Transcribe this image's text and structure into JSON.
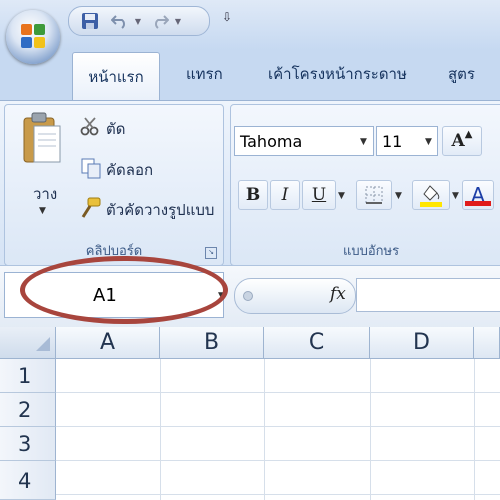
{
  "quick_access": {
    "icons": [
      "save-icon",
      "undo-icon",
      "redo-icon",
      "customize-icon"
    ]
  },
  "tabs": [
    "หน้าแรก",
    "แทรก",
    "เค้าโครงหน้ากระดาษ",
    "สูตร"
  ],
  "clipboard": {
    "paste_label": "วาง",
    "cut_label": "ตัด",
    "copy_label": "คัดลอก",
    "format_painter_label": "ตัวคัดวางรูปแบบ",
    "group_label": "คลิปบอร์ด"
  },
  "font": {
    "font_name": "Tahoma",
    "font_size": "11",
    "bold": "B",
    "italic": "I",
    "underline": "U",
    "grow_font": "A",
    "font_color_label": "A",
    "group_label": "แบบอักษร"
  },
  "formula_bar": {
    "name_box": "A1",
    "fx": "fx",
    "formula": ""
  },
  "grid": {
    "columns": [
      "A",
      "B",
      "C",
      "D"
    ],
    "rows": [
      "1",
      "2",
      "3",
      "4"
    ]
  },
  "colors": {
    "highlight_oval": "#a8453d",
    "ribbon": "#dbe7f6",
    "font_color": "#e01b1b",
    "fill_color": "#ffe600"
  }
}
